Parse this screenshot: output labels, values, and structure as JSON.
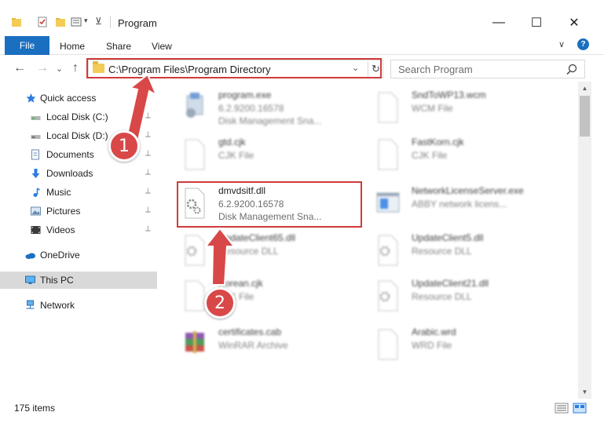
{
  "window": {
    "title": "Program",
    "minimize_glyph": "—",
    "maximize_glyph": "☐",
    "close_glyph": "✕"
  },
  "ribbon": {
    "tabs": [
      "File",
      "Home",
      "Share",
      "View"
    ],
    "help": "?",
    "expand_glyph": "∨"
  },
  "address": {
    "path": "C:\\Program Files\\Program Directory",
    "back": "←",
    "forward": "→",
    "recent": "⌄",
    "up": "↑",
    "dropdown": "⌄",
    "refresh": "↻"
  },
  "search": {
    "placeholder": "Search Program"
  },
  "sidebar": {
    "items": [
      {
        "label": "Quick access",
        "icon": "star-icon",
        "pinned": false
      },
      {
        "label": "Local Disk (C:)",
        "icon": "drive-icon",
        "pinned": true
      },
      {
        "label": "Local Disk (D:)",
        "icon": "drive-icon",
        "pinned": true
      },
      {
        "label": "Documents",
        "icon": "documents-icon",
        "pinned": true
      },
      {
        "label": "Downloads",
        "icon": "download-icon",
        "pinned": true
      },
      {
        "label": "Music",
        "icon": "music-icon",
        "pinned": true
      },
      {
        "label": "Pictures",
        "icon": "pictures-icon",
        "pinned": true
      },
      {
        "label": "Videos",
        "icon": "videos-icon",
        "pinned": true
      },
      {
        "label": "OneDrive",
        "icon": "cloud-icon",
        "pinned": false
      },
      {
        "label": "This PC",
        "icon": "computer-icon",
        "pinned": false
      },
      {
        "label": "Network",
        "icon": "network-icon",
        "pinned": false
      }
    ],
    "pin_glyph": "📌"
  },
  "files": [
    {
      "name": "program.exe",
      "line2": "6.2.9200.16578",
      "line3": "Disk Management Sna...",
      "icon": "exe-icon"
    },
    {
      "name": "SndToWP13.wcm",
      "line2": "WCM File",
      "line3": "",
      "icon": "blank-file-icon"
    },
    {
      "name": "gtd.cjk",
      "line2": "CJK File",
      "line3": "",
      "icon": "blank-file-icon"
    },
    {
      "name": "FastKorn.cjk",
      "line2": "CJK File",
      "line3": "",
      "icon": "blank-file-icon"
    },
    {
      "name": "dmvdsitf.dll",
      "line2": "6.2.9200.16578",
      "line3": "Disk Management Sna...",
      "icon": "dll-icon"
    },
    {
      "name": "NetworkLicenseServer.exe",
      "line2": "ABBY network licens...",
      "line3": "",
      "icon": "app-window-icon"
    },
    {
      "name": "UpdateClient65.dll",
      "line2": "Resource DLL",
      "line3": "",
      "icon": "dll-icon"
    },
    {
      "name": "UpdateClient5.dll",
      "line2": "Resource DLL",
      "line3": "",
      "icon": "dll-icon"
    },
    {
      "name": "Korean.cjk",
      "line2": "CJK File",
      "line3": "",
      "icon": "blank-file-icon"
    },
    {
      "name": "UpdateClient21.dll",
      "line2": "Resource DLL",
      "line3": "",
      "icon": "dll-icon"
    },
    {
      "name": "certificates.cab",
      "line2": "WinRAR Archive",
      "line3": "",
      "icon": "archive-icon"
    },
    {
      "name": "Arabic.wrd",
      "line2": "WRD File",
      "line3": "",
      "icon": "blank-file-icon"
    }
  ],
  "status": {
    "item_count": "175 items"
  },
  "steps": [
    "1",
    "2"
  ],
  "colors": {
    "accent": "#1a6fc0",
    "highlight": "#d23a3a",
    "marker": "#d94848",
    "folder": "#f3cb57"
  }
}
